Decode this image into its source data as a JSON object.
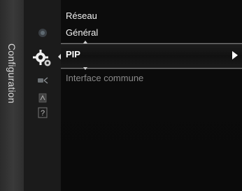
{
  "sidebar": {
    "label": "Configuration"
  },
  "icons": [
    "sound-icon",
    "setup-gear-icon",
    "input-icon",
    "application-icon",
    "help-icon"
  ],
  "menu": {
    "items": [
      {
        "label": "Réseau"
      },
      {
        "label": "Général"
      },
      {
        "label": "PIP",
        "selected": true
      },
      {
        "label": "Interface commune",
        "disabled": true
      }
    ]
  },
  "colors": {
    "selected_text": "#ffffff",
    "disabled_text": "#8a8a8a",
    "background": "#0b0b0b"
  }
}
